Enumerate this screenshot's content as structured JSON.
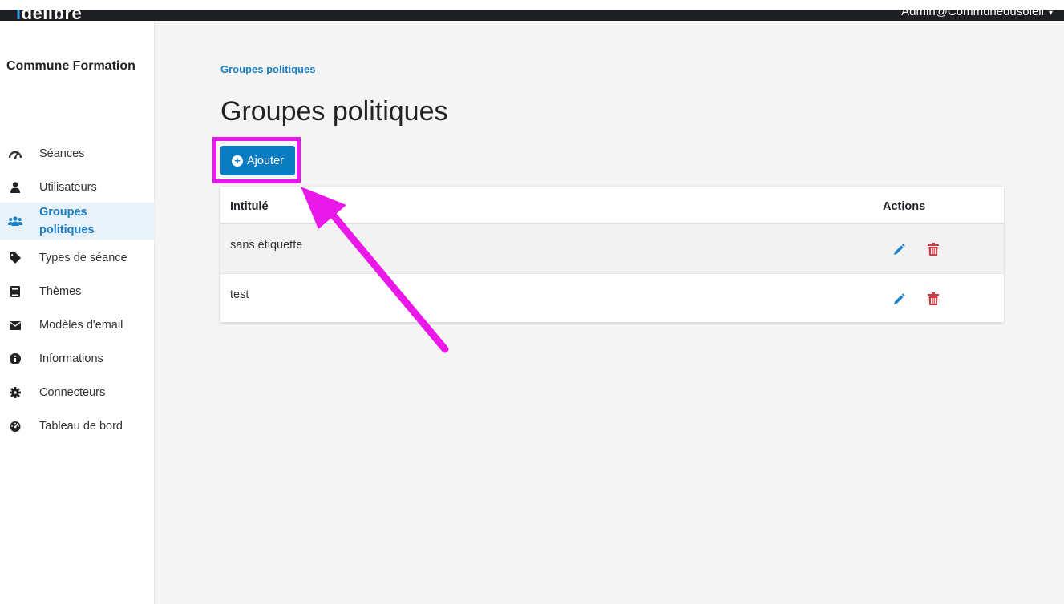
{
  "topbar": {
    "brand_prefix": "i",
    "brand_text": "delibre",
    "user": "Admin@Communedusoleil"
  },
  "sidebar": {
    "org_name": "Commune Formation",
    "items": [
      {
        "label": "Séances",
        "icon": "gauge-icon"
      },
      {
        "label": "Utilisateurs",
        "icon": "user-icon"
      },
      {
        "label": "Groupes politiques",
        "icon": "users-icon",
        "active": true
      },
      {
        "label": "Types de séance",
        "icon": "tag-icon"
      },
      {
        "label": "Thèmes",
        "icon": "book-icon"
      },
      {
        "label": "Modèles d'email",
        "icon": "envelope-icon"
      },
      {
        "label": "Informations",
        "icon": "info-icon"
      },
      {
        "label": "Connecteurs",
        "icon": "gear-icon"
      },
      {
        "label": "Tableau de bord",
        "icon": "dashboard-icon"
      }
    ]
  },
  "main": {
    "breadcrumb": "Groupes politiques",
    "title": "Groupes politiques",
    "add_button": "Ajouter",
    "table": {
      "headers": {
        "title": "Intitulé",
        "actions": "Actions"
      },
      "rows": [
        {
          "title": "sans étiquette"
        },
        {
          "title": "test"
        }
      ]
    }
  },
  "colors": {
    "accent": "#0a7cc2",
    "danger": "#d9363e",
    "annotation": "#ea19ea",
    "topbar": "#1d1f22"
  }
}
